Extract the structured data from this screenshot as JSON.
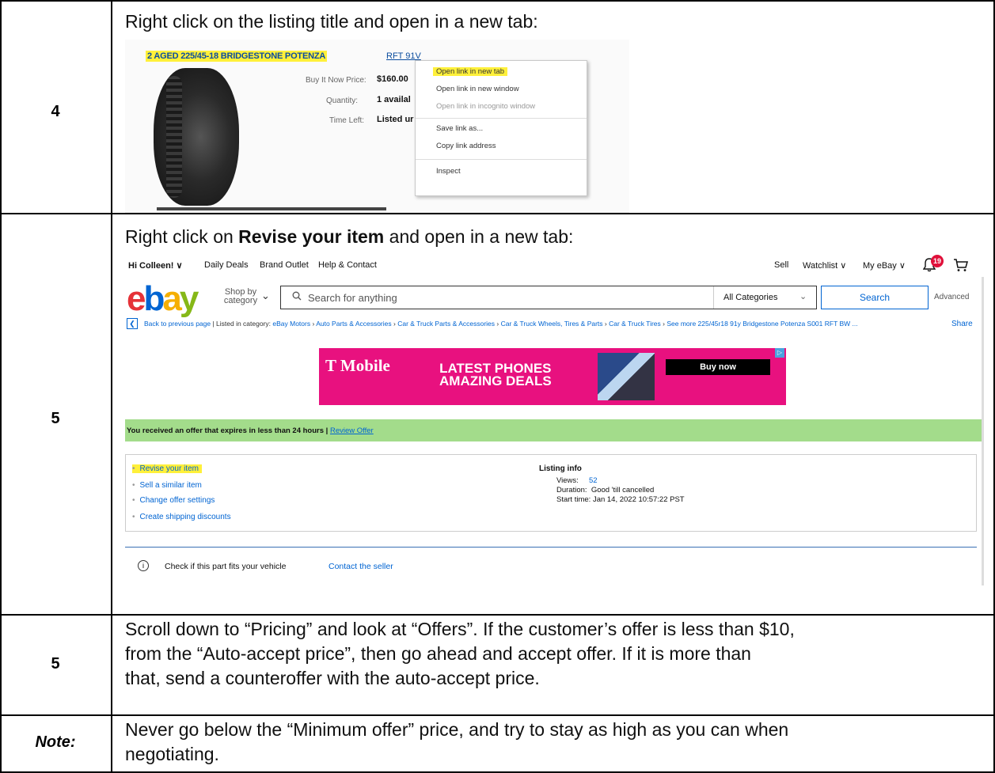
{
  "rows": [
    {
      "num": "4",
      "text": "Right click on the listing title and open in a new tab:"
    },
    {
      "num": "5",
      "text_before": "Right click on ",
      "text_bold": "Revise your item",
      "text_after": " and open in a new tab:"
    },
    {
      "num": "5",
      "lines": [
        "Scroll down to “Pricing” and look at “Offers”. If the customer’s offer is less than $10,",
        "from the “Auto-accept price”, then go ahead and accept offer. If it is more than",
        "that, send a counteroffer with the auto-accept price."
      ]
    },
    {
      "num": "Note:",
      "lines": [
        "Never go below the “Minimum offer” price, and try to stay as high as you can when",
        "negotiating."
      ]
    }
  ],
  "shot1": {
    "title_highlighted": "2 AGED 225/45-18 BRIDGESTONE POTENZA",
    "title_rest": "RFT 91V",
    "labels": [
      "Buy It Now Price:",
      "Quantity:",
      "Time Left:"
    ],
    "values": [
      "$160.00",
      "1 availal",
      "Listed ur"
    ],
    "menu": [
      {
        "label": "Open link in new tab",
        "highlighted": true
      },
      {
        "label": "Open link in new window"
      },
      {
        "label": "Open link in incognito window",
        "disabled": true
      },
      {
        "label": "Save link as..."
      },
      {
        "label": "Copy link address"
      },
      {
        "label": "Inspect"
      }
    ]
  },
  "shot2": {
    "top_left": [
      "Hi Colleen! ∨",
      "Daily Deals",
      "Brand Outlet",
      "Help & Contact"
    ],
    "top_right": [
      "Sell",
      "Watchlist ∨",
      "My eBay ∨"
    ],
    "notif_count": "19",
    "logo": {
      "e": "e",
      "b": "b",
      "a": "a",
      "y": "y"
    },
    "shop_by": "Shop by category",
    "search_placeholder": "Search for anything",
    "category": "All Categories",
    "search_button": "Search",
    "advanced": "Advanced",
    "breadcrumb_prefix": "Back to previous page  |  Listed in category:",
    "breadcrumbs": [
      "eBay Motors",
      "Auto Parts & Accessories",
      "Car & Truck Parts & Accessories",
      "Car & Truck Wheels, Tires & Parts",
      "Car & Truck Tires",
      "See more 225/45r18 91y Bridgestone Potenza S001 RFT BW ..."
    ],
    "share": "Share",
    "ad": {
      "brand": "T Mobile",
      "line1": "LATEST PHONES",
      "line2": "AMAZING DEALS",
      "cta": "Buy now"
    },
    "offer_text": "You received an offer that expires in less than 24 hours  |  ",
    "offer_link": "Review Offer",
    "actions": [
      "Revise your item",
      "Sell a similar item",
      "Change offer settings",
      "Create shipping discounts"
    ],
    "listing_info_title": "Listing info",
    "listing_info": [
      {
        "label": "Views:",
        "value": "52"
      },
      {
        "label": "Duration:",
        "value": "Good 'till cancelled"
      },
      {
        "label": "Start time:",
        "value": "Jan 14, 2022 10:57:22 PST"
      }
    ],
    "fits_text": "Check if this part fits your vehicle",
    "contact": "Contact the seller"
  }
}
